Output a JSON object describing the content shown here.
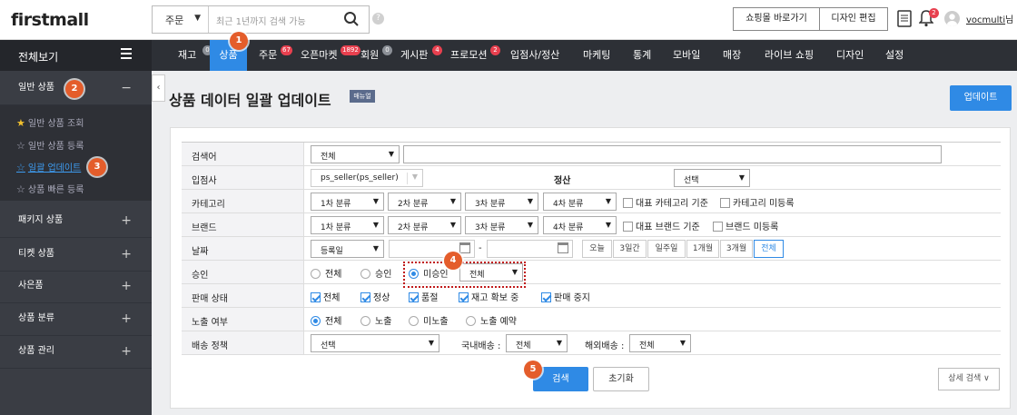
{
  "header": {
    "logo": "firstmall",
    "search_select": "주문",
    "search_placeholder": "최근 1년까지 검색 가능",
    "help": "?",
    "shop_button": "쇼핑몰 바로가기",
    "design_button": "디자인 편집",
    "bell_badge": "2",
    "username": "vocmulti",
    "username_suffix": "님"
  },
  "nav": {
    "all_view": "전체보기",
    "items": [
      {
        "label": "재고",
        "badge": "0",
        "badge_color": "gray"
      },
      {
        "label": "상품",
        "active": true
      },
      {
        "label": "주문",
        "badge": "67",
        "badge_color": "red"
      },
      {
        "label": "오픈마켓",
        "badge": "1892",
        "badge_color": "red"
      },
      {
        "label": "회원",
        "badge": "0",
        "badge_color": "gray"
      },
      {
        "label": "게시판",
        "badge": "4",
        "badge_color": "red"
      },
      {
        "label": "프로모션",
        "badge": "2",
        "badge_color": "red"
      },
      {
        "label": "입점사/정산"
      },
      {
        "label": "마케팅"
      },
      {
        "label": "통계"
      },
      {
        "label": "모바일"
      },
      {
        "label": "매장"
      },
      {
        "label": "라이브 쇼핑"
      },
      {
        "label": "디자인"
      },
      {
        "label": "설정"
      }
    ]
  },
  "sidebar": {
    "groups": [
      {
        "label": "일반 상품",
        "toggle": "−"
      },
      {
        "label": "패키지 상품",
        "toggle": "+"
      },
      {
        "label": "티켓 상품",
        "toggle": "+"
      },
      {
        "label": "사은품",
        "toggle": "+"
      },
      {
        "label": "상품 분류",
        "toggle": "+"
      },
      {
        "label": "상품 관리",
        "toggle": "+"
      }
    ],
    "sub_items": [
      {
        "label": "일반 상품 조회",
        "starred": true
      },
      {
        "label": "일반 상품 등록"
      },
      {
        "label": "일괄 업데이트",
        "active": true
      },
      {
        "label": "상품 빠른 등록"
      }
    ],
    "collapse": "‹"
  },
  "page": {
    "title": "상품 데이터 일괄 업데이트",
    "manual_badge": "매뉴얼",
    "update_button": "업데이트"
  },
  "form": {
    "search_word": {
      "label": "검색어",
      "select": "전체",
      "value": ""
    },
    "seller": {
      "label": "입점사",
      "value": "ps_seller(ps_seller)"
    },
    "settlement": {
      "label": "정산",
      "select": "선택"
    },
    "category": {
      "label": "카테고리",
      "selects": [
        "1차 분류",
        "2차 분류",
        "3차 분류",
        "4차 분류"
      ],
      "checks": [
        "대표 카테고리 기준",
        "카테고리 미등록"
      ]
    },
    "brand": {
      "label": "브랜드",
      "selects": [
        "1차 분류",
        "2차 분류",
        "3차 분류",
        "4차 분류"
      ],
      "checks": [
        "대표 브랜드 기준",
        "브랜드 미등록"
      ]
    },
    "date": {
      "label": "날짜",
      "select": "등록일",
      "separator": "-",
      "buttons": [
        "오늘",
        "3일간",
        "일주일",
        "1개월",
        "3개월",
        "전체"
      ],
      "active": "전체"
    },
    "approval": {
      "label": "승인",
      "options": [
        "전체",
        "승인",
        "미승인"
      ],
      "selected": "미승인",
      "sub_select": "전체"
    },
    "sale_status": {
      "label": "판매 상태",
      "options": [
        "전체",
        "정상",
        "품절",
        "재고 확보 중",
        "판매 중지"
      ]
    },
    "exposure": {
      "label": "노출 여부",
      "options": [
        "전체",
        "노출",
        "미노출",
        "노출 예약"
      ],
      "selected": "전체"
    },
    "shipping": {
      "label": "배송 정책",
      "select": "선택",
      "domestic_label": "국내배송 :",
      "domestic_select": "전체",
      "overseas_label": "해외배송 :",
      "overseas_select": "전체"
    }
  },
  "buttons": {
    "search": "검색",
    "reset": "초기화",
    "detail": "상세 검색 ∨"
  },
  "steps": [
    "1",
    "2",
    "3",
    "4",
    "5"
  ],
  "colors": {
    "accent": "#2f8ae5",
    "nav_bg": "#2d3036",
    "step": "#e45d2b",
    "badge_red": "#e8404f"
  }
}
